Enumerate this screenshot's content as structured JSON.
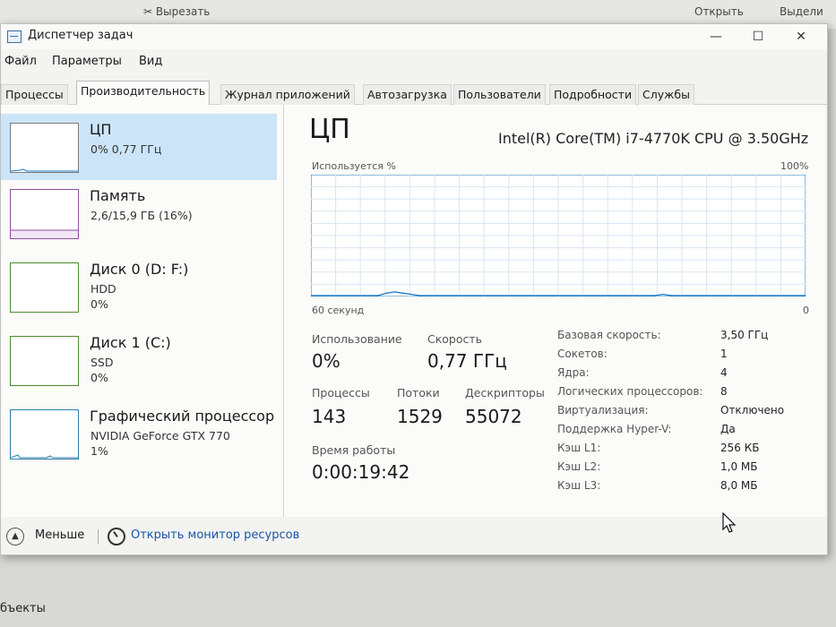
{
  "background": {
    "cut_label": "Вырезать",
    "open_label": "Открыть",
    "select_label": "Выдели",
    "bottom_caption": "бъекты"
  },
  "window": {
    "title": "Диспетчер задач",
    "controls": {
      "minimize": "—",
      "maximize": "☐",
      "close": "✕"
    }
  },
  "menu": [
    "Файл",
    "Параметры",
    "Вид"
  ],
  "tabs": [
    {
      "label": "Процессы"
    },
    {
      "label": "Производительность",
      "active": true
    },
    {
      "label": "Журнал приложений"
    },
    {
      "label": "Автозагрузка"
    },
    {
      "label": "Пользователи"
    },
    {
      "label": "Подробности"
    },
    {
      "label": "Службы"
    }
  ],
  "resources": [
    {
      "title": "ЦП",
      "sub1": "0% 0,77 ГГц",
      "sub2": "",
      "selected": true
    },
    {
      "title": "Память",
      "sub1": "2,6/15,9 ГБ (16%)",
      "sub2": ""
    },
    {
      "title": "Диск 0 (D: F:)",
      "sub1": "HDD",
      "sub2": "0%"
    },
    {
      "title": "Диск 1 (C:)",
      "sub1": "SSD",
      "sub2": "0%"
    },
    {
      "title": "Графический процессор",
      "sub1": "NVIDIA GeForce GTX 770",
      "sub2": "1%"
    }
  ],
  "cpu": {
    "title": "ЦП",
    "name": "Intel(R) Core(TM) i7-4770K CPU @ 3.50GHz",
    "graph_label": "Используется %",
    "graph_max": "100%",
    "graph_time": "60 секунд",
    "graph_min": "0",
    "usage_percent_series": [
      0,
      0,
      0,
      0,
      0,
      0,
      0,
      0,
      0,
      2,
      3,
      2,
      1,
      0,
      0,
      0,
      0,
      0,
      0,
      0,
      0,
      0,
      0,
      0,
      0,
      0,
      0,
      0,
      0,
      0,
      0,
      0,
      0,
      0,
      0,
      0,
      0,
      0,
      0,
      0,
      0,
      0,
      1,
      0,
      0,
      0,
      0,
      0,
      0,
      0,
      0,
      0,
      0,
      0,
      0,
      0,
      0,
      0,
      0,
      0
    ],
    "stats": {
      "usage_label": "Использование",
      "usage_value": "0%",
      "speed_label": "Скорость",
      "speed_value": "0,77 ГГц",
      "processes_label": "Процессы",
      "processes_value": "143",
      "threads_label": "Потоки",
      "threads_value": "1529",
      "handles_label": "Дескрипторы",
      "handles_value": "55072",
      "uptime_label": "Время работы",
      "uptime_value": "0:00:19:42"
    },
    "specs": [
      {
        "label": "Базовая скорость:",
        "value": "3,50 ГГц"
      },
      {
        "label": "Сокетов:",
        "value": "1"
      },
      {
        "label": "Ядра:",
        "value": "4"
      },
      {
        "label": "Логических процессоров:",
        "value": "8"
      },
      {
        "label": "Виртуализация:",
        "value": "Отключено"
      },
      {
        "label": "Поддержка Hyper-V:",
        "value": "Да"
      },
      {
        "label": "Кэш L1:",
        "value": "256 КБ"
      },
      {
        "label": "Кэш L2:",
        "value": "1,0 МБ"
      },
      {
        "label": "Кэш L3:",
        "value": "8,0 МБ"
      }
    ]
  },
  "footer": {
    "fewer_label": "Меньше",
    "monitor_label": "Открыть монитор ресурсов"
  },
  "colors": {
    "accent": "#cce4f7",
    "graph_line": "#1879c6",
    "graph_grid": "#d9e6f2"
  }
}
